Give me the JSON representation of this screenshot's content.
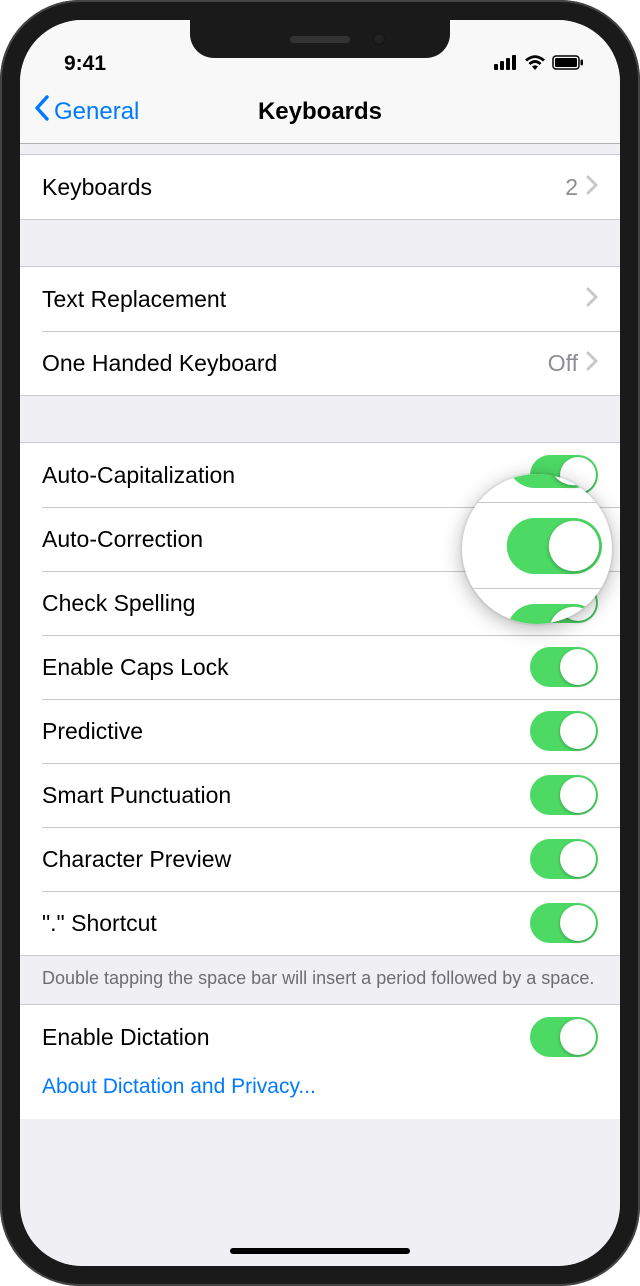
{
  "status": {
    "time": "9:41"
  },
  "nav": {
    "back": "General",
    "title": "Keyboards"
  },
  "rows": {
    "keyboards": {
      "label": "Keyboards",
      "value": "2"
    },
    "text_replacement": {
      "label": "Text Replacement"
    },
    "one_handed": {
      "label": "One Handed Keyboard",
      "value": "Off"
    },
    "auto_cap": {
      "label": "Auto-Capitalization",
      "on": true
    },
    "auto_correct": {
      "label": "Auto-Correction",
      "on": true
    },
    "check_spelling": {
      "label": "Check Spelling",
      "on": true
    },
    "caps_lock": {
      "label": "Enable Caps Lock",
      "on": true
    },
    "predictive": {
      "label": "Predictive",
      "on": true
    },
    "smart_punct": {
      "label": "Smart Punctuation",
      "on": true
    },
    "char_preview": {
      "label": "Character Preview",
      "on": true
    },
    "period_shortcut": {
      "label": "\".\" Shortcut",
      "on": true
    },
    "dictation": {
      "label": "Enable Dictation",
      "on": true
    }
  },
  "footer": "Double tapping the space bar will insert a period followed by a space.",
  "dictation_link": "About Dictation and Privacy..."
}
